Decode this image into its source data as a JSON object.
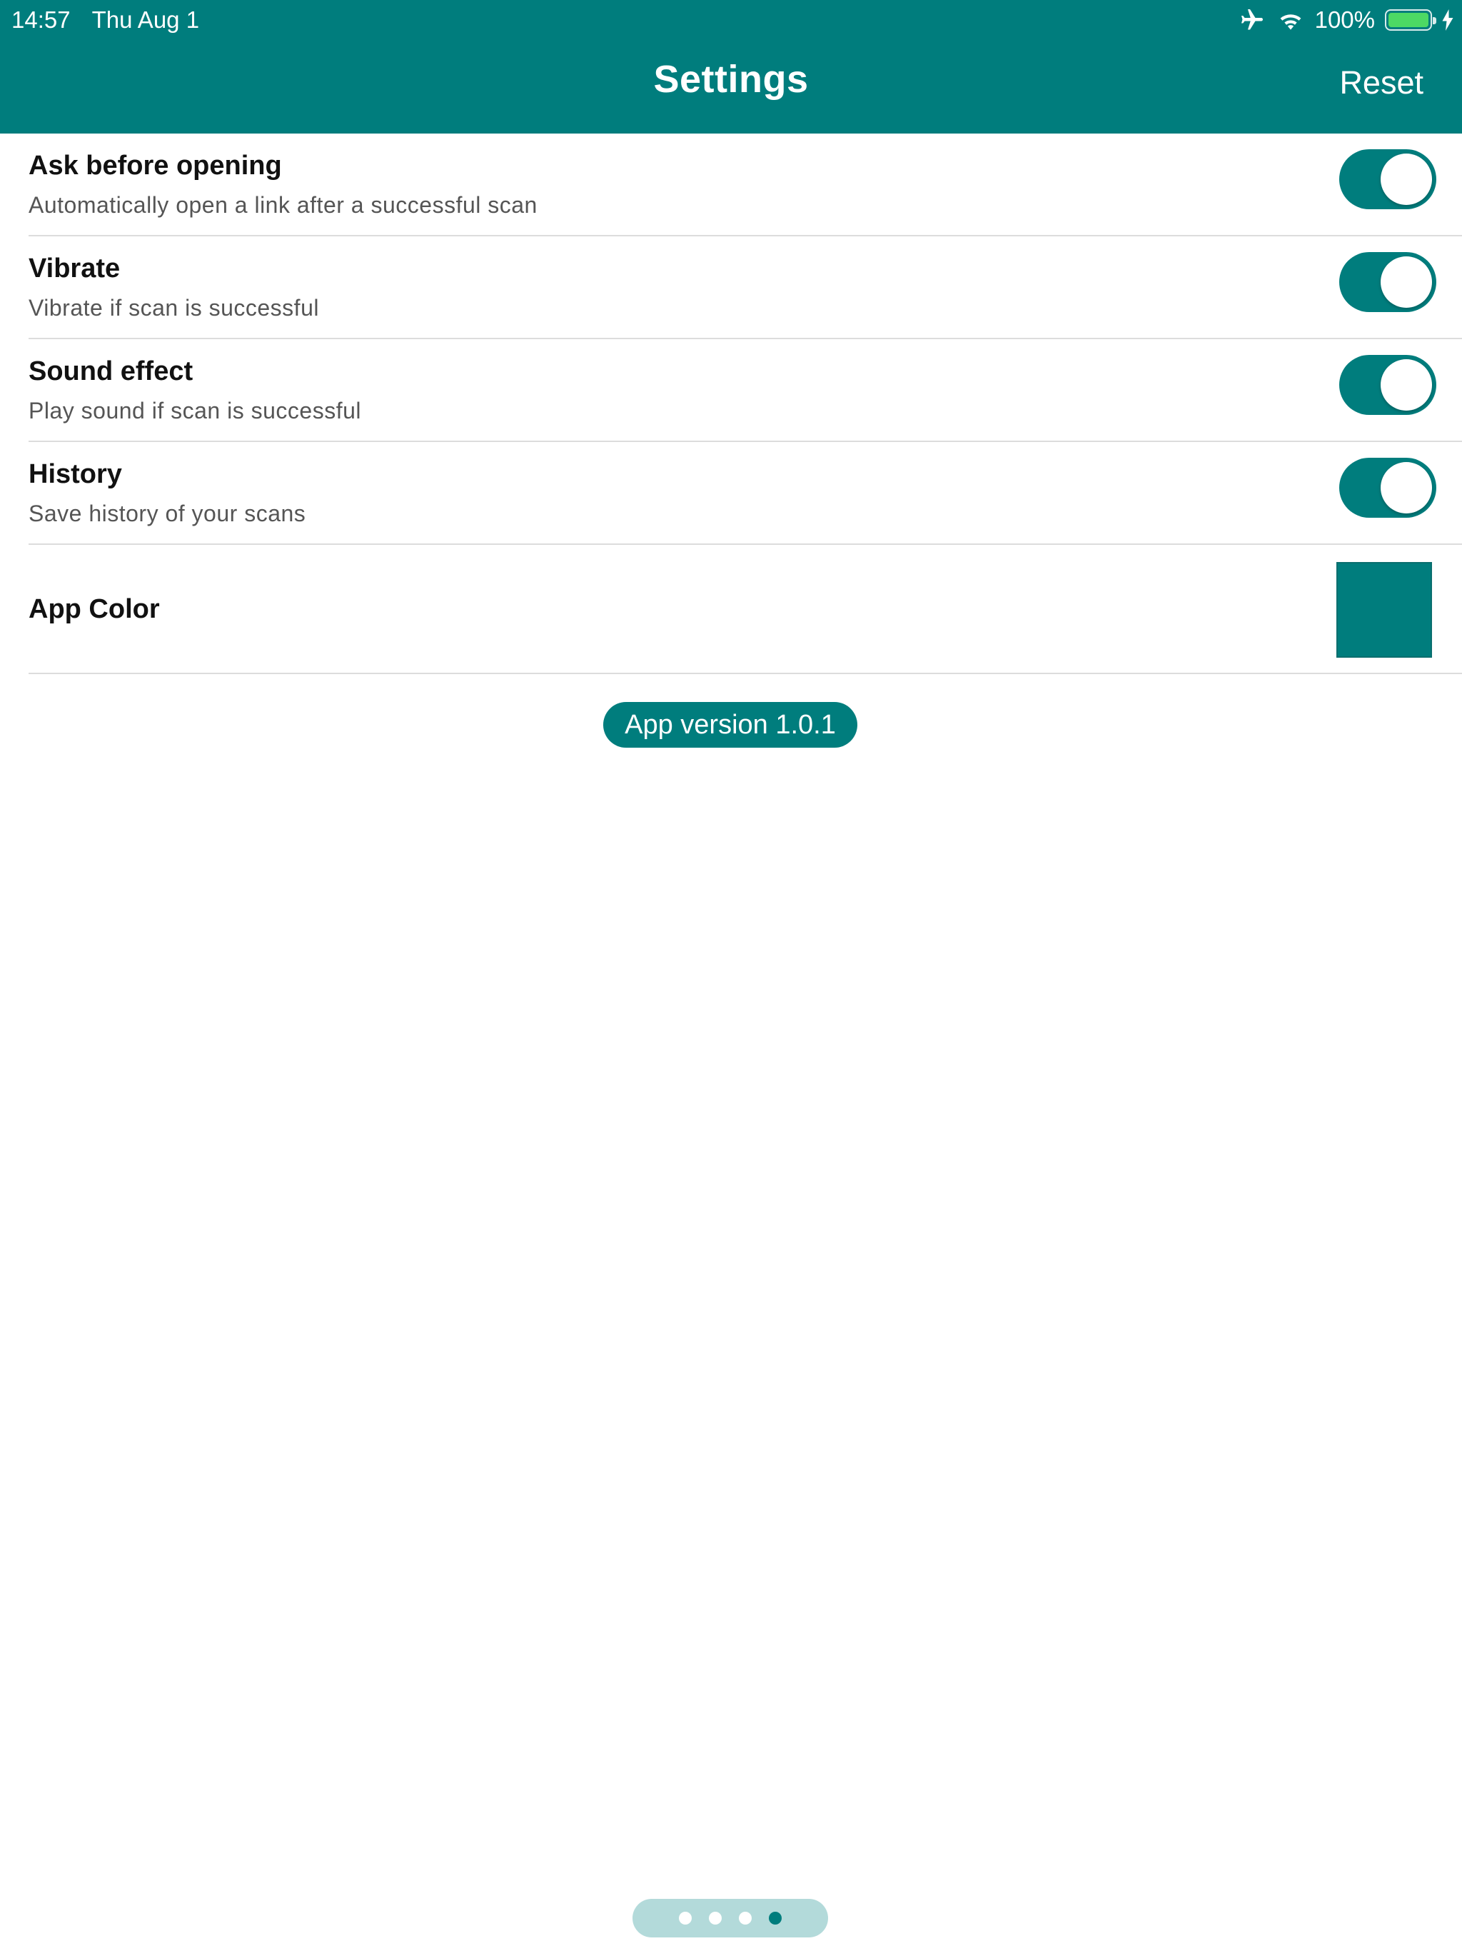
{
  "status_bar": {
    "time": "14:57",
    "date": "Thu Aug 1",
    "battery": "100%",
    "airplane_icon": "airplane-icon",
    "wifi_icon": "wifi-icon",
    "battery_icon": "battery-icon",
    "charging_icon": "charging-bolt-icon"
  },
  "header": {
    "title": "Settings",
    "reset_label": "Reset"
  },
  "settings": [
    {
      "title": "Ask before opening",
      "description": "Automatically open a link after a successful scan",
      "enabled": true
    },
    {
      "title": "Vibrate",
      "description": "Vibrate if scan is successful",
      "enabled": true
    },
    {
      "title": "Sound effect",
      "description": "Play sound if scan is successful",
      "enabled": true
    },
    {
      "title": "History",
      "description": "Save history of your scans",
      "enabled": true
    }
  ],
  "app_color": {
    "label": "App Color",
    "value": "#007D7D"
  },
  "version_label": "App version 1.0.1",
  "page_indicator": {
    "count": 4,
    "active_index": 4
  },
  "colors": {
    "accent": "#007D7D",
    "indicator_bg": "#B3DADA",
    "battery_green": "#4CD964"
  }
}
